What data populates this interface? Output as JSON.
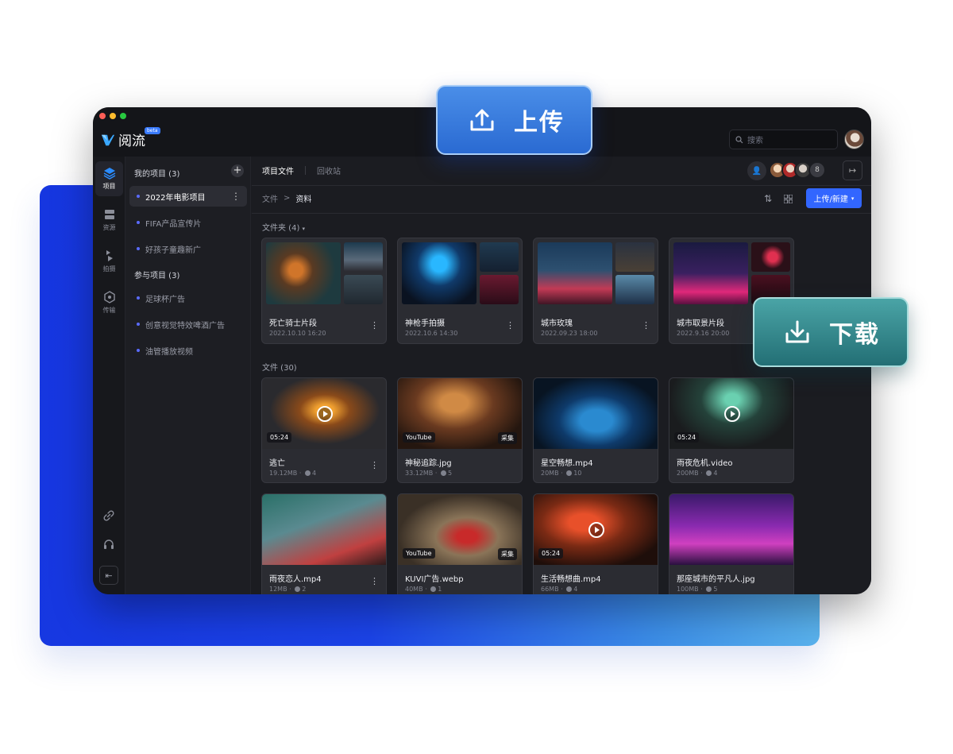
{
  "app": {
    "name": "阅流",
    "beta": "beta"
  },
  "search": {
    "placeholder": "搜索"
  },
  "rail": {
    "items": [
      {
        "label": "项目",
        "icon": "layers-icon",
        "active": true
      },
      {
        "label": "资源",
        "icon": "storage-icon",
        "active": false
      },
      {
        "label": "拍摄",
        "icon": "camera-icon",
        "active": false
      },
      {
        "label": "传输",
        "icon": "transfer-icon",
        "active": false
      }
    ],
    "bottom": [
      "link-icon",
      "headset-icon"
    ],
    "collapse": "⇤"
  },
  "projects": {
    "my_header": "我的项目 (3)",
    "my_items": [
      "2022年电影项目",
      "FIFA产品宣传片",
      "好孩子童趣新广"
    ],
    "join_header": "参与项目 (3)",
    "join_items": [
      "足球杯广告",
      "创意视觉特效啤酒广告",
      "油管播放视频"
    ]
  },
  "main": {
    "tab_files": "项目文件",
    "tab_trash": "回收站",
    "member_count": "8",
    "breadcrumb": {
      "root": "文件",
      "sep": ">",
      "current": "资料"
    },
    "upload_new": "上传/新建",
    "folders_label": "文件夹 (4)",
    "files_label": "文件 (30)"
  },
  "folders": [
    {
      "name": "死亡骑士片段",
      "date": "2022.10.10 16:20"
    },
    {
      "name": "神枪手拍摄",
      "date": "2022.10.6 14:30"
    },
    {
      "name": "城市玫瑰",
      "date": "2022.09.23 18:00"
    },
    {
      "name": "城市取景片段",
      "date": "2022.9.16 20:00"
    }
  ],
  "files": [
    {
      "name": "逃亡",
      "size": "19.12MB",
      "comments": "4",
      "badge_left": "05:24",
      "badge_right": "",
      "play": true
    },
    {
      "name": "神秘追踪.jpg",
      "size": "33.12MB",
      "comments": "5",
      "badge_left": "YouTube",
      "badge_right": "采集",
      "play": false
    },
    {
      "name": "星空畅想.mp4",
      "size": "20MB",
      "comments": "10",
      "badge_left": "",
      "badge_right": "",
      "play": false
    },
    {
      "name": "雨夜危机.video",
      "size": "200MB",
      "comments": "4",
      "badge_left": "05:24",
      "badge_right": "",
      "play": true
    },
    {
      "name": "雨夜恋人.mp4",
      "size": "12MB",
      "comments": "2",
      "badge_left": "",
      "badge_right": "",
      "play": false
    },
    {
      "name": "KUVI广告.webp",
      "size": "40MB",
      "comments": "1",
      "badge_left": "YouTube",
      "badge_right": "采集",
      "play": false
    },
    {
      "name": "生活畅想曲.mp4",
      "size": "66MB",
      "comments": "4",
      "badge_left": "05:24",
      "badge_right": "",
      "play": true
    },
    {
      "name": "那座城市的平凡人.jpg",
      "size": "100MB",
      "comments": "5",
      "badge_left": "",
      "badge_right": "",
      "play": false
    }
  ],
  "overlay": {
    "upload": "上传",
    "download": "下载"
  },
  "colors": {
    "accent": "#3266ff",
    "upload_btn": "#2a6ad2",
    "download_btn": "#236f75"
  }
}
